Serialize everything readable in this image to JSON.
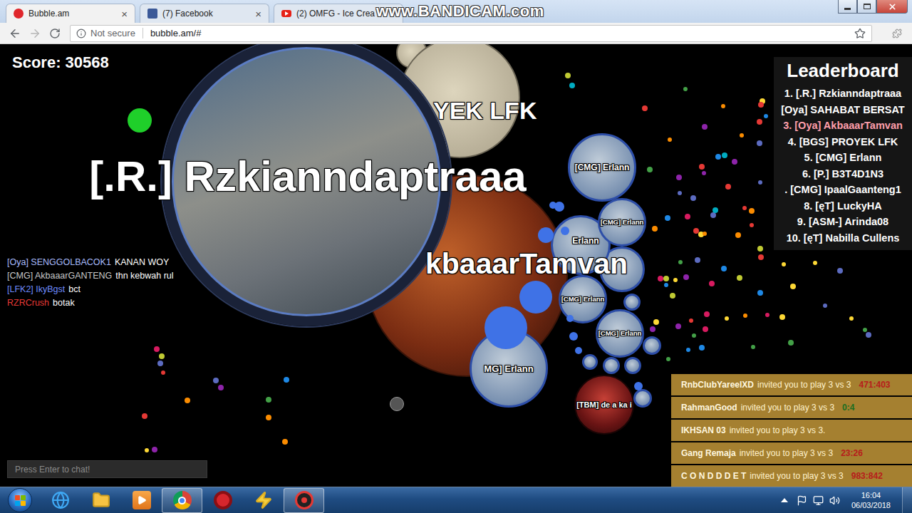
{
  "browser": {
    "tabs": [
      {
        "title": "Bubble.am",
        "icon": "bubble",
        "close": "×",
        "selected": true
      },
      {
        "title": "(7) Facebook",
        "icon": "facebook",
        "close": "×",
        "selected": false
      },
      {
        "title": "(2) OMFG - Ice Crea",
        "icon": "youtube",
        "selected": false
      }
    ],
    "nav": {
      "back_enabled": true,
      "forward_enabled": false
    },
    "security": "Not secure",
    "url": "bubble.am/#",
    "watermark": "www.BANDICAM.com"
  },
  "game": {
    "score": {
      "label": "Score:",
      "value": "30568"
    },
    "leaderboard": {
      "title": "Leaderboard",
      "entries": [
        {
          "text": "1. [.R.] Rzkianndaptraaa",
          "highlighted": false
        },
        {
          "text": "[Oya] SAHABAT BERSAT",
          "highlighted": false
        },
        {
          "text": "3. [Oya] AkbaaarTamvan",
          "highlighted": true
        },
        {
          "text": "4. [BGS] PROYEK LFK",
          "highlighted": false
        },
        {
          "text": "5. [CMG] Erlann",
          "highlighted": false
        },
        {
          "text": "6. [P.] B3T4D1N3",
          "highlighted": false
        },
        {
          "text": ". [CMG] IpaalGaanteng1",
          "highlighted": false
        },
        {
          "text": "8. [ęT] LuckyHA",
          "highlighted": false
        },
        {
          "text": "9. [ASM-] Arinda08",
          "highlighted": false
        },
        {
          "text": "10. [ęT] Nabilla Cullens",
          "highlighted": false
        }
      ]
    },
    "cells": [
      {
        "name": "[.R.] Rzkianndaptraaa",
        "kind": "hero"
      },
      {
        "name": "kbaaarTamvan",
        "kind": "photo"
      },
      {
        "name": "YEK LFK",
        "kind": "photo"
      },
      {
        "name": "[CMG] Erlann",
        "kind": "clan"
      },
      {
        "name": "Erlann",
        "kind": "clan"
      },
      {
        "name": "[CMG] Erlann",
        "kind": "clan"
      },
      {
        "name": "[CMG] Erlann",
        "kind": "clan"
      },
      {
        "name": "[CMG] Erlann",
        "kind": "clan"
      },
      {
        "name": "MG] Erlann",
        "kind": "clan"
      },
      {
        "name": "[TBM] de a ka i",
        "kind": "blood"
      }
    ],
    "chat": {
      "messages": [
        {
          "name": "[Oya] SENGGOLBACOK1",
          "message": "KANAN WOY",
          "color": "#a9bcff"
        },
        {
          "name": "[CMG] AkbaaarGANTENG",
          "message": "thn kebwah rul",
          "color": "#c8c8c8"
        },
        {
          "name": "[LFK2] IkyBgst",
          "message": "bct",
          "color": "#6f8cff"
        },
        {
          "name": "RZRCrush",
          "message": "botak",
          "color": "#e53935"
        }
      ],
      "placeholder": "Press Enter to chat!"
    },
    "invitations": [
      {
        "name": "RnbClubYareelXD",
        "text": "invited you to play 3 vs 3",
        "score": "471:403",
        "color": "#b71c1c"
      },
      {
        "name": "RahmanGood",
        "text": "invited you to play 3 vs 3",
        "score": "0:4",
        "color": "#1b6e20"
      },
      {
        "name": "IKHSAN 03",
        "text": "invited you to play 3 vs 3."
      },
      {
        "name": "Gang Remaja",
        "text": "invited you to play 3 vs 3",
        "score": "23:26",
        "color": "#b71c1c"
      },
      {
        "name": "C O N D D D E T",
        "text": "invited you to play 3 vs 3",
        "score": "983:842",
        "color": "#b71c1c"
      }
    ]
  },
  "taskbar": {
    "apps": [
      {
        "kind": "ie",
        "active": false
      },
      {
        "kind": "explorer",
        "active": false
      },
      {
        "kind": "media",
        "active": false
      },
      {
        "kind": "chrome",
        "active": true
      },
      {
        "kind": "garena",
        "active": false
      },
      {
        "kind": "bolt",
        "active": false
      },
      {
        "kind": "bandicam",
        "active": true
      }
    ],
    "clock": {
      "time": "16:04",
      "date": "06/03/2018"
    }
  }
}
